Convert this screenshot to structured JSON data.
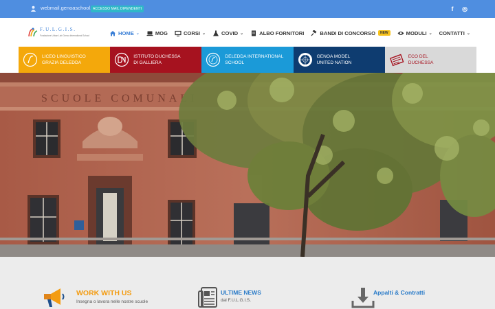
{
  "topbar": {
    "email": "webmail.genoaschool.eu",
    "staff_link": "ACCESSO MAIL DIPENDENTI",
    "social_facebook": "f",
    "social_instagram": "◎"
  },
  "logo": {
    "name": "F.U.L.G.I.S.",
    "subtitle": "Fondazione Urban Lab Genoa International School"
  },
  "nav": [
    {
      "label": "HOME",
      "icon": "home-icon",
      "has_dropdown": true,
      "active": true
    },
    {
      "label": "MOG",
      "icon": "laptop-icon",
      "has_dropdown": false
    },
    {
      "label": "CORSI",
      "icon": "graduation-icon",
      "has_dropdown": true
    },
    {
      "label": "COVID",
      "icon": "flask-icon",
      "has_dropdown": true
    },
    {
      "label": "ALBO FORNITORI",
      "icon": "document-icon",
      "has_dropdown": false
    },
    {
      "label": "BANDI DI CONCORSO",
      "icon": "gavel-icon",
      "has_dropdown": false,
      "badge": "NEW"
    },
    {
      "label": "MODULI",
      "icon": "eye-icon",
      "has_dropdown": true
    },
    {
      "label": "CONTATTI",
      "icon": "",
      "has_dropdown": true
    }
  ],
  "tiles": [
    {
      "line1": "LICEO LINGUISTICO",
      "line2": "GRAZIA DELEDDA",
      "color": "#f4a80b"
    },
    {
      "line1": "ISTITUTO DUCHESSA",
      "line2": "DI GALLIERA",
      "color": "#a6121f"
    },
    {
      "line1": "DELEDDA INTERNATIONAL",
      "line2": "SCHOOL",
      "color": "#1b9ad8"
    },
    {
      "line1": "GENOA MODEL",
      "line2": "UNITED NATION",
      "color": "#0e3c70"
    },
    {
      "line1": "ECO DEL",
      "line2": "DUCHESSA",
      "color": "#d9d9d9"
    }
  ],
  "hero": {
    "facade_inscription": "SCUOLE COMUNALI"
  },
  "features": [
    {
      "title": "WORK WITH US",
      "subtitle": "Insegna o lavora nelle nostre scuole",
      "icon": "megaphone-icon"
    },
    {
      "title": "ULTIME NEWS",
      "subtitle": "dal F.U.L.G.I.S.",
      "icon": "newspaper-icon"
    },
    {
      "title": "Appalti & Contratti",
      "subtitle": "",
      "icon": "download-icon"
    }
  ],
  "colors": {
    "topbar": "#4f8ee0",
    "accent": "#3a7fd6",
    "orange": "#f39c12"
  }
}
